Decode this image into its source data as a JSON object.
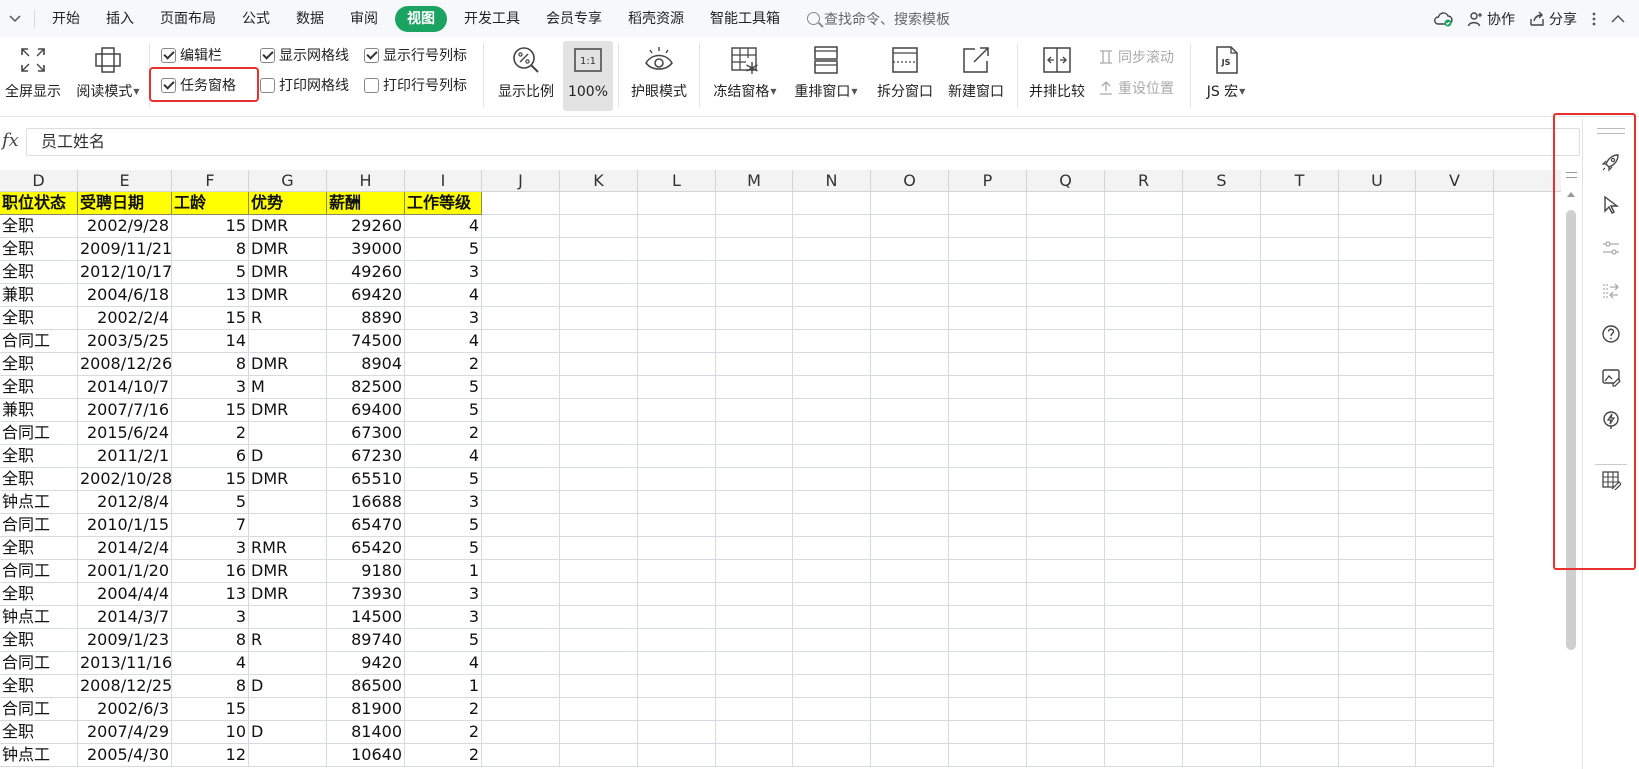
{
  "menu": {
    "tabs": [
      "开始",
      "插入",
      "页面布局",
      "公式",
      "数据",
      "审阅",
      "视图",
      "开发工具",
      "会员专享",
      "稻壳资源",
      "智能工具箱"
    ],
    "active_tab": "视图",
    "search_placeholder": "查找命令、搜索模板",
    "collab_label": "协作",
    "share_label": "分享"
  },
  "ribbon": {
    "fullscreen": "全屏显示",
    "reading_mode": "阅读模式",
    "formula_bar_cb": "编辑栏",
    "show_gridlines_cb": "显示网格线",
    "show_headings_cb": "显示行号列标",
    "task_pane_cb": "任务窗格",
    "print_gridlines_cb": "打印网格线",
    "print_headings_cb": "打印行号列标",
    "zoom_ratio": "显示比例",
    "zoom_100": "100%",
    "zoom_100_icon_text": "1:1",
    "eye_mode": "护眼模式",
    "freeze_panes": "冻结窗格",
    "rearrange_windows": "重排窗口",
    "split_window": "拆分窗口",
    "new_window": "新建窗口",
    "side_by_side": "并排比较",
    "sync_scroll": "同步滚动",
    "reset_position": "重设位置",
    "js_macro": "JS 宏",
    "js_icon_text": "JS"
  },
  "formula": {
    "fx_label": "fx",
    "content": "员工姓名"
  },
  "columns": [
    "D",
    "E",
    "F",
    "G",
    "H",
    "I",
    "J",
    "K",
    "L",
    "M",
    "N",
    "O",
    "P",
    "Q",
    "R",
    "S",
    "T",
    "U",
    "V"
  ],
  "table": {
    "headers": [
      "职位状态",
      "受聘日期",
      "工龄",
      "优势",
      "薪酬",
      "工作等级"
    ],
    "rows": [
      [
        "全职",
        "2002/9/28",
        "15",
        "DMR",
        "29260",
        "4"
      ],
      [
        "全职",
        "2009/11/21",
        "8",
        "DMR",
        "39000",
        "5"
      ],
      [
        "全职",
        "2012/10/17",
        "5",
        "DMR",
        "49260",
        "3"
      ],
      [
        "兼职",
        "2004/6/18",
        "13",
        "DMR",
        "69420",
        "4"
      ],
      [
        "全职",
        "2002/2/4",
        "15",
        "R",
        "8890",
        "3"
      ],
      [
        "合同工",
        "2003/5/25",
        "14",
        "",
        "74500",
        "4"
      ],
      [
        "全职",
        "2008/12/26",
        "8",
        "DMR",
        "8904",
        "2"
      ],
      [
        "全职",
        "2014/10/7",
        "3",
        "M",
        "82500",
        "5"
      ],
      [
        "兼职",
        "2007/7/16",
        "15",
        "DMR",
        "69400",
        "5"
      ],
      [
        "合同工",
        "2015/6/24",
        "2",
        "",
        "67300",
        "2"
      ],
      [
        "全职",
        "2011/2/1",
        "6",
        "D",
        "67230",
        "4"
      ],
      [
        "全职",
        "2002/10/28",
        "15",
        "DMR",
        "65510",
        "5"
      ],
      [
        "钟点工",
        "2012/8/4",
        "5",
        "",
        "16688",
        "3"
      ],
      [
        "合同工",
        "2010/1/15",
        "7",
        "",
        "65470",
        "5"
      ],
      [
        "全职",
        "2014/2/4",
        "3",
        "RMR",
        "65420",
        "5"
      ],
      [
        "合同工",
        "2001/1/20",
        "16",
        "DMR",
        "9180",
        "1"
      ],
      [
        "全职",
        "2004/4/4",
        "13",
        "DMR",
        "73930",
        "3"
      ],
      [
        "钟点工",
        "2014/3/7",
        "3",
        "",
        "14500",
        "3"
      ],
      [
        "全职",
        "2009/1/23",
        "8",
        "R",
        "89740",
        "5"
      ],
      [
        "合同工",
        "2013/11/16",
        "4",
        "",
        "9420",
        "4"
      ],
      [
        "全职",
        "2008/12/25",
        "8",
        "D",
        "86500",
        "1"
      ],
      [
        "合同工",
        "2002/6/3",
        "15",
        "",
        "81900",
        "2"
      ],
      [
        "全职",
        "2007/4/29",
        "10",
        "D",
        "81400",
        "2"
      ],
      [
        "钟点工",
        "2005/4/30",
        "12",
        "",
        "10640",
        "2"
      ]
    ]
  },
  "task_pane": {
    "icons": [
      "rocket-icon",
      "cursor-icon",
      "slider-settings-icon",
      "transfer-icon",
      "help-icon",
      "image-edit-icon",
      "lightning-icon",
      "table-edit-icon"
    ]
  },
  "colors": {
    "accent_green": "#1aa361",
    "header_fill": "#ffff00",
    "highlight_red": "#e8302f"
  }
}
